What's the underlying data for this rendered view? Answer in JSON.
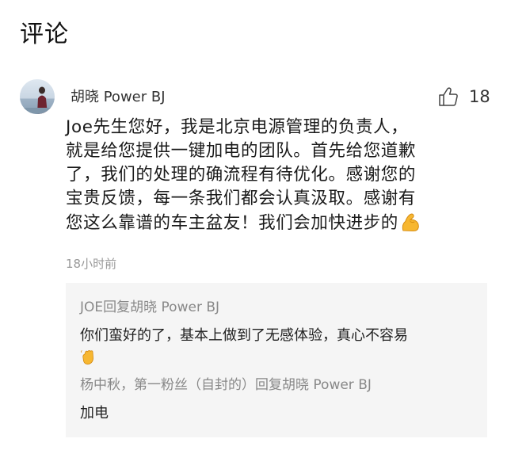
{
  "section": {
    "title": "评论"
  },
  "comment": {
    "author": "胡晓 Power BJ",
    "likes": "18",
    "like_icon": "thumbs-up-outline-icon",
    "avatar_icon": "avatar-photo",
    "body_lines": [
      "Joe先生您好，我是北京电源管理的负责人，",
      "就是给您提供一键加电的团队。首先给您道歉",
      "了，我们的处理的确流程有待优化。感谢您的",
      "宝贵反馈，每一条我们都会认真汲取。感谢有",
      "您这么靠谱的车主盆友！我们会加快进步的"
    ],
    "body_trailing_emoji": "flexed-biceps-icon",
    "timestamp": "18小时前"
  },
  "replies": [
    {
      "header": "JOE回复胡晓 Power BJ",
      "text": "你们蛮好的了，基本上做到了无感体验，真心不容易",
      "trailing_emoji": "waving-hand-icon"
    },
    {
      "header": "杨中秋，第一粉丝（自封的）回复胡晓 Power BJ",
      "text": "加电"
    }
  ],
  "colors": {
    "reply_background": "#f5f5f5",
    "muted_text": "#999999",
    "emoji_yellow": "#f7b731"
  }
}
